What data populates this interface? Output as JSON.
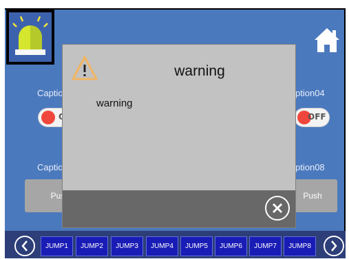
{
  "captions": {
    "left_top": "Captio",
    "right_top": "ption04",
    "left_bottom": "Captio",
    "right_bottom": "ption08"
  },
  "toggles": {
    "left_label": "O",
    "right_label": "OFF"
  },
  "push_buttons": {
    "left_label": "Pus",
    "right_label": "Push"
  },
  "dialog": {
    "title": "warning",
    "message": "warning"
  },
  "nav": {
    "jumps": [
      "JUMP1",
      "JUMP2",
      "JUMP3",
      "JUMP4",
      "JUMP5",
      "JUMP6",
      "JUMP7",
      "JUMP8"
    ]
  },
  "icons": {
    "alarm": "alarm-light-icon",
    "home": "home-icon",
    "warning": "warning-triangle-icon",
    "close": "close-circle-icon",
    "prev": "chevron-left-icon",
    "next": "chevron-right-icon"
  },
  "colors": {
    "screen_bg": "#4b79bd",
    "jump_button": "#1a1cb6",
    "dialog_bg": "#c2c2c2",
    "toggle_knob": "#f0473c"
  }
}
